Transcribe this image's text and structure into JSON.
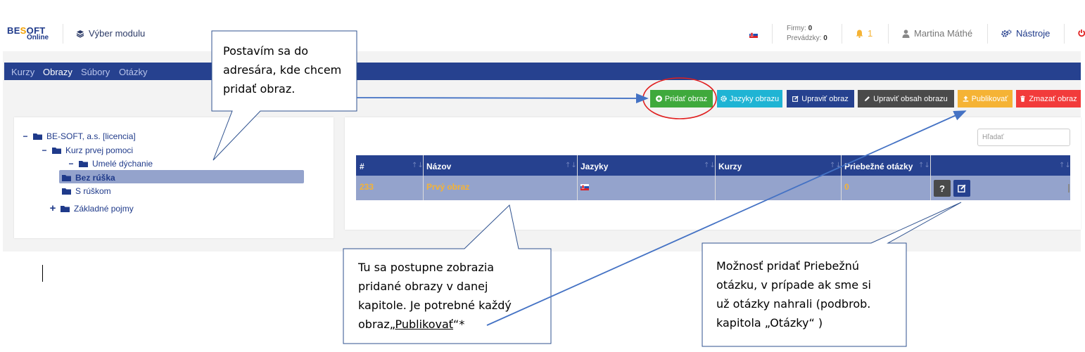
{
  "header": {
    "logo_main_a": "BE",
    "logo_main_o": "S",
    "logo_main_b": "OFT",
    "logo_sub": "Online",
    "module_select": "Výber modulu",
    "firmy_label": "Firmy:",
    "firmy_value": "0",
    "prevadzky_label": "Prevádzky:",
    "prevadzky_value": "0",
    "notifications_count": "1",
    "user_name": "Martina Máthé",
    "tools_label": "Nástroje"
  },
  "nav": {
    "items": [
      "Kurzy",
      "Obrazy",
      "Súbory",
      "Otázky"
    ],
    "active": "Obrazy"
  },
  "toolbar": {
    "add_image": "Pridať obraz",
    "image_languages": "Jazyky obrazu",
    "edit_image": "Upraviť obraz",
    "edit_image_content": "Upraviť obsah obrazu",
    "publish": "Publikovať",
    "delete_image": "Zmazať obraz"
  },
  "colors": {
    "primary": "#26418f",
    "success": "#3fa93c",
    "info": "#1fb4d4",
    "dark": "#4a4a4a",
    "warning": "#f5b335",
    "danger": "#f23b3b",
    "selection": "#94a3cc",
    "annotation": "#4472c4",
    "highlight_circle": "#e02020"
  },
  "tree": {
    "items": [
      {
        "label": "BE-SOFT, a.s. [licencia]",
        "toggle": "−",
        "level": 0
      },
      {
        "label": "Kurz prvej pomoci",
        "toggle": "−",
        "level": 1
      },
      {
        "label": "Umelé dýchanie",
        "toggle": "−",
        "level": 2
      },
      {
        "label": "Bez rúška",
        "toggle": "",
        "level": 3,
        "selected": true
      },
      {
        "label": "S rúškom",
        "toggle": "",
        "level": 3
      },
      {
        "label": "Základné pojmy",
        "toggle": "+",
        "level": 1
      }
    ]
  },
  "table": {
    "search_placeholder": "Hľadať",
    "columns": [
      "#",
      "Názov",
      "Jazyky",
      "Kurzy",
      "Priebežné otázky",
      ""
    ],
    "sort_glyph": "↑↓",
    "rows": [
      {
        "id": "233",
        "name": "Prvý obraz",
        "languages": "sk-flag",
        "courses": "",
        "questions": "0"
      }
    ],
    "action_help": "?"
  },
  "callouts": {
    "top": [
      "Postavím sa do",
      "adresára, kde chcem",
      "pridať obraz."
    ],
    "bottom_left": [
      "Tu sa postupne zobrazia",
      "pridané obrazy v danej",
      "kapitole. Je potrebné každý"
    ],
    "bottom_left_last_prefix": "obraz„",
    "bottom_left_last_underlined": "Publikovať",
    "bottom_left_last_suffix": "“*",
    "bottom_right": [
      "Možnosť pridať Priebežnú",
      "otázku, v prípade ak sme si",
      "už otázky nahrali (podbrob.",
      "kapitola „Otázky“ )"
    ]
  }
}
